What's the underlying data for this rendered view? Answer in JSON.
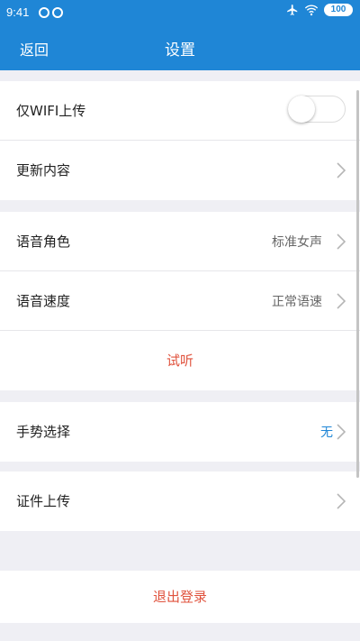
{
  "status_bar": {
    "time": "9:41",
    "battery": "100",
    "icons": [
      "circle-icon",
      "circle-icon",
      "airplane-icon",
      "wifi-icon",
      "battery-icon"
    ]
  },
  "nav": {
    "back_label": "返回",
    "title": "设置"
  },
  "groups": {
    "upload": {
      "wifi_only_label": "仅WIFI上传",
      "wifi_only_on": false,
      "update_label": "更新内容"
    },
    "voice": {
      "role_label": "语音角色",
      "role_value": "标准女声",
      "speed_label": "语音速度",
      "speed_value": "正常语速",
      "preview_label": "试听"
    },
    "gesture": {
      "label": "手势选择",
      "value": "无"
    },
    "certificate": {
      "label": "证件上传"
    },
    "logout": {
      "label": "退出登录"
    }
  },
  "colors": {
    "primary": "#1f86d6",
    "accent_red": "#e0533e",
    "background": "#efeff4"
  }
}
